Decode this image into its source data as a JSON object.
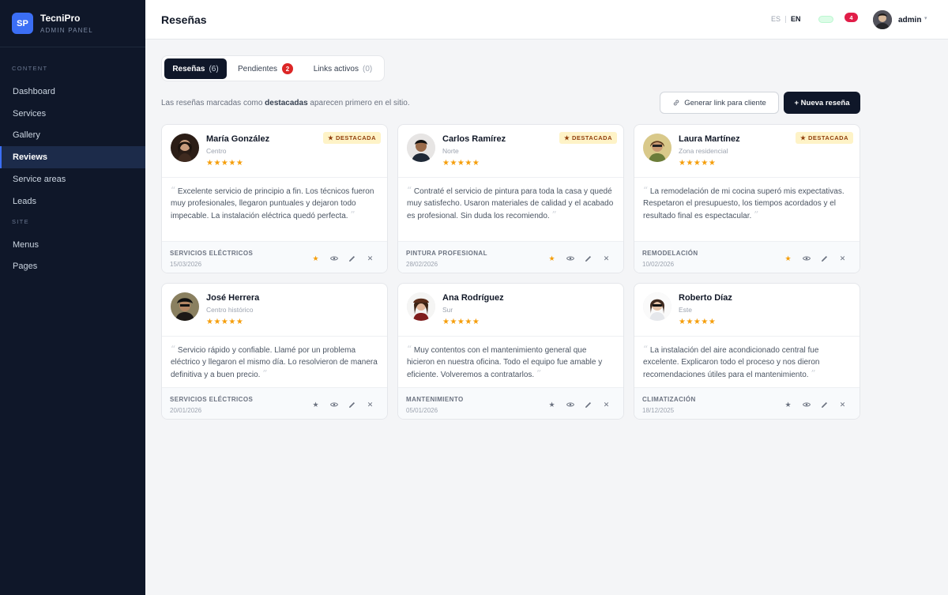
{
  "brand": {
    "logo": "SP",
    "name": "TecniPro",
    "sub": "ADMIN PANEL"
  },
  "sidebar": {
    "content_label": "CONTENT",
    "content_items": [
      {
        "label": "Dashboard"
      },
      {
        "label": "Services"
      },
      {
        "label": "Gallery"
      },
      {
        "label": "Reviews"
      },
      {
        "label": "Service areas"
      },
      {
        "label": "Leads"
      }
    ],
    "active": "Reviews",
    "site_label": "SITE",
    "site_items": [
      {
        "label": "Menus"
      },
      {
        "label": "Pages"
      }
    ]
  },
  "header": {
    "title": "Reseñas",
    "lang_es": "ES",
    "lang_en": "EN",
    "notifications": "4",
    "user": "admin"
  },
  "tabs": [
    {
      "label": "Reseñas",
      "count": "(6)"
    },
    {
      "label": "Pendientes",
      "badge": "2"
    },
    {
      "label": "Links activos",
      "count": "(0)"
    }
  ],
  "info": {
    "pre": "Las reseñas marcadas como ",
    "bold": "destacadas",
    "post": " aparecen primero en el sitio."
  },
  "buttons": {
    "link": "Generar link para cliente",
    "new": "+ Nueva reseña"
  },
  "featured_label": "★ DESTACADA",
  "colors": {
    "accent": "#3b6ef5",
    "sidebar": "#0f1729",
    "star": "#f59e0b",
    "danger": "#dc2626"
  },
  "reviews": [
    {
      "name": "María González",
      "location": "Centro",
      "stars": "★★★★★",
      "featured": true,
      "text": "Excelente servicio de principio a fin. Los técnicos fueron muy profesionales, llegaron puntuales y dejaron todo impecable. La instalación eléctrica quedó perfecta.",
      "category": "SERVICIOS ELÉCTRICOS",
      "date": "15/03/2026"
    },
    {
      "name": "Carlos Ramírez",
      "location": "Norte",
      "stars": "★★★★★",
      "featured": true,
      "text": "Contraté el servicio de pintura para toda la casa y quedé muy satisfecho. Usaron materiales de calidad y el acabado es profesional. Sin duda los recomiendo.",
      "category": "PINTURA PROFESIONAL",
      "date": "28/02/2026"
    },
    {
      "name": "Laura Martínez",
      "location": "Zona residencial",
      "stars": "★★★★★",
      "featured": true,
      "text": "La remodelación de mi cocina superó mis expectativas. Respetaron el presupuesto, los tiempos acordados y el resultado final es espectacular.",
      "category": "REMODELACIÓN",
      "date": "10/02/2026"
    },
    {
      "name": "José Herrera",
      "location": "Centro histórico",
      "stars": "★★★★★",
      "featured": false,
      "text": "Servicio rápido y confiable. Llamé por un problema eléctrico y llegaron el mismo día. Lo resolvieron de manera definitiva y a buen precio.",
      "category": "SERVICIOS ELÉCTRICOS",
      "date": "20/01/2026"
    },
    {
      "name": "Ana Rodríguez",
      "location": "Sur",
      "stars": "★★★★★",
      "featured": false,
      "text": "Muy contentos con el mantenimiento general que hicieron en nuestra oficina. Todo el equipo fue amable y eficiente. Volveremos a contratarlos.",
      "category": "MANTENIMIENTO",
      "date": "05/01/2026"
    },
    {
      "name": "Roberto Díaz",
      "location": "Este",
      "stars": "★★★★★",
      "featured": false,
      "text": "La instalación del aire acondicionado central fue excelente. Explicaron todo el proceso y nos dieron recomendaciones útiles para el mantenimiento.",
      "category": "CLIMATIZACIÓN",
      "date": "18/12/2025"
    }
  ]
}
